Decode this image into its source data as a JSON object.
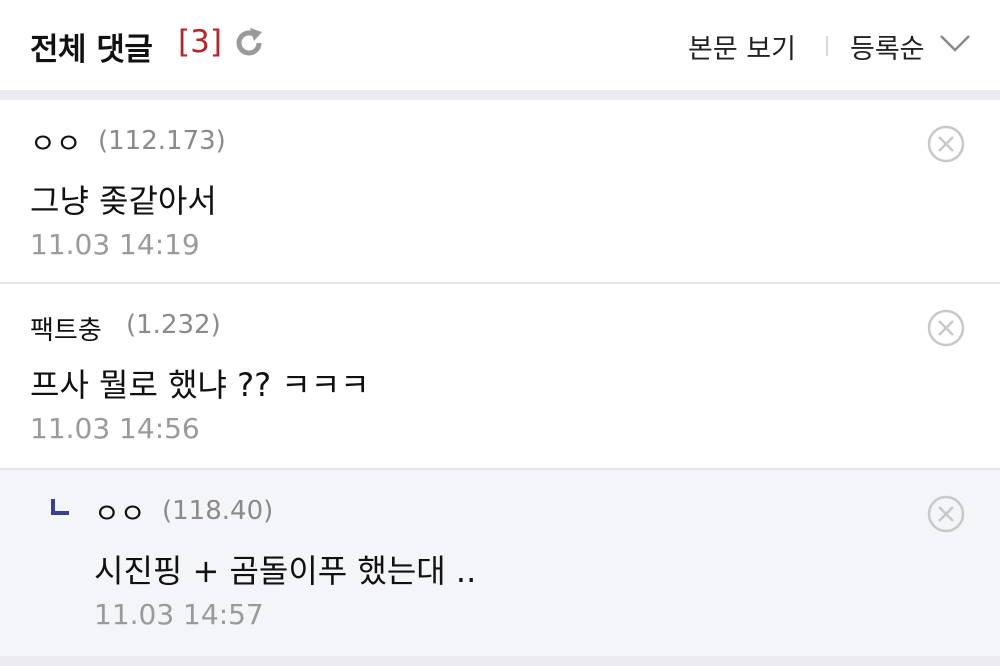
{
  "header": {
    "title": "전체 댓글",
    "count": "[3]",
    "view_body_label": "본문 보기",
    "sort_label": "등록순"
  },
  "icons": {
    "refresh": "refresh-icon",
    "sort_dropdown": "chevron-down-icon",
    "delete": "circle-x-icon",
    "reply": "reply-corner-icon"
  },
  "colors": {
    "count": "#b3262c",
    "reply_background": "#f4f5f9",
    "reply_mark": "#3b3f8f"
  },
  "comments": [
    {
      "author": "ㅇㅇ",
      "ip": "(112.173)",
      "text": "그냥 좆같아서",
      "time": "11.03 14:19",
      "is_reply": false
    },
    {
      "author": "팩트충",
      "ip": "(1.232)",
      "text": "프사 뭘로 했냐 ?? ㅋㅋㅋ",
      "time": "11.03 14:56",
      "is_reply": false
    },
    {
      "author": "ㅇㅇ",
      "ip": "(118.40)",
      "text": "시진핑 + 곰돌이푸 했는대 ..",
      "time": "11.03 14:57",
      "is_reply": true
    }
  ]
}
